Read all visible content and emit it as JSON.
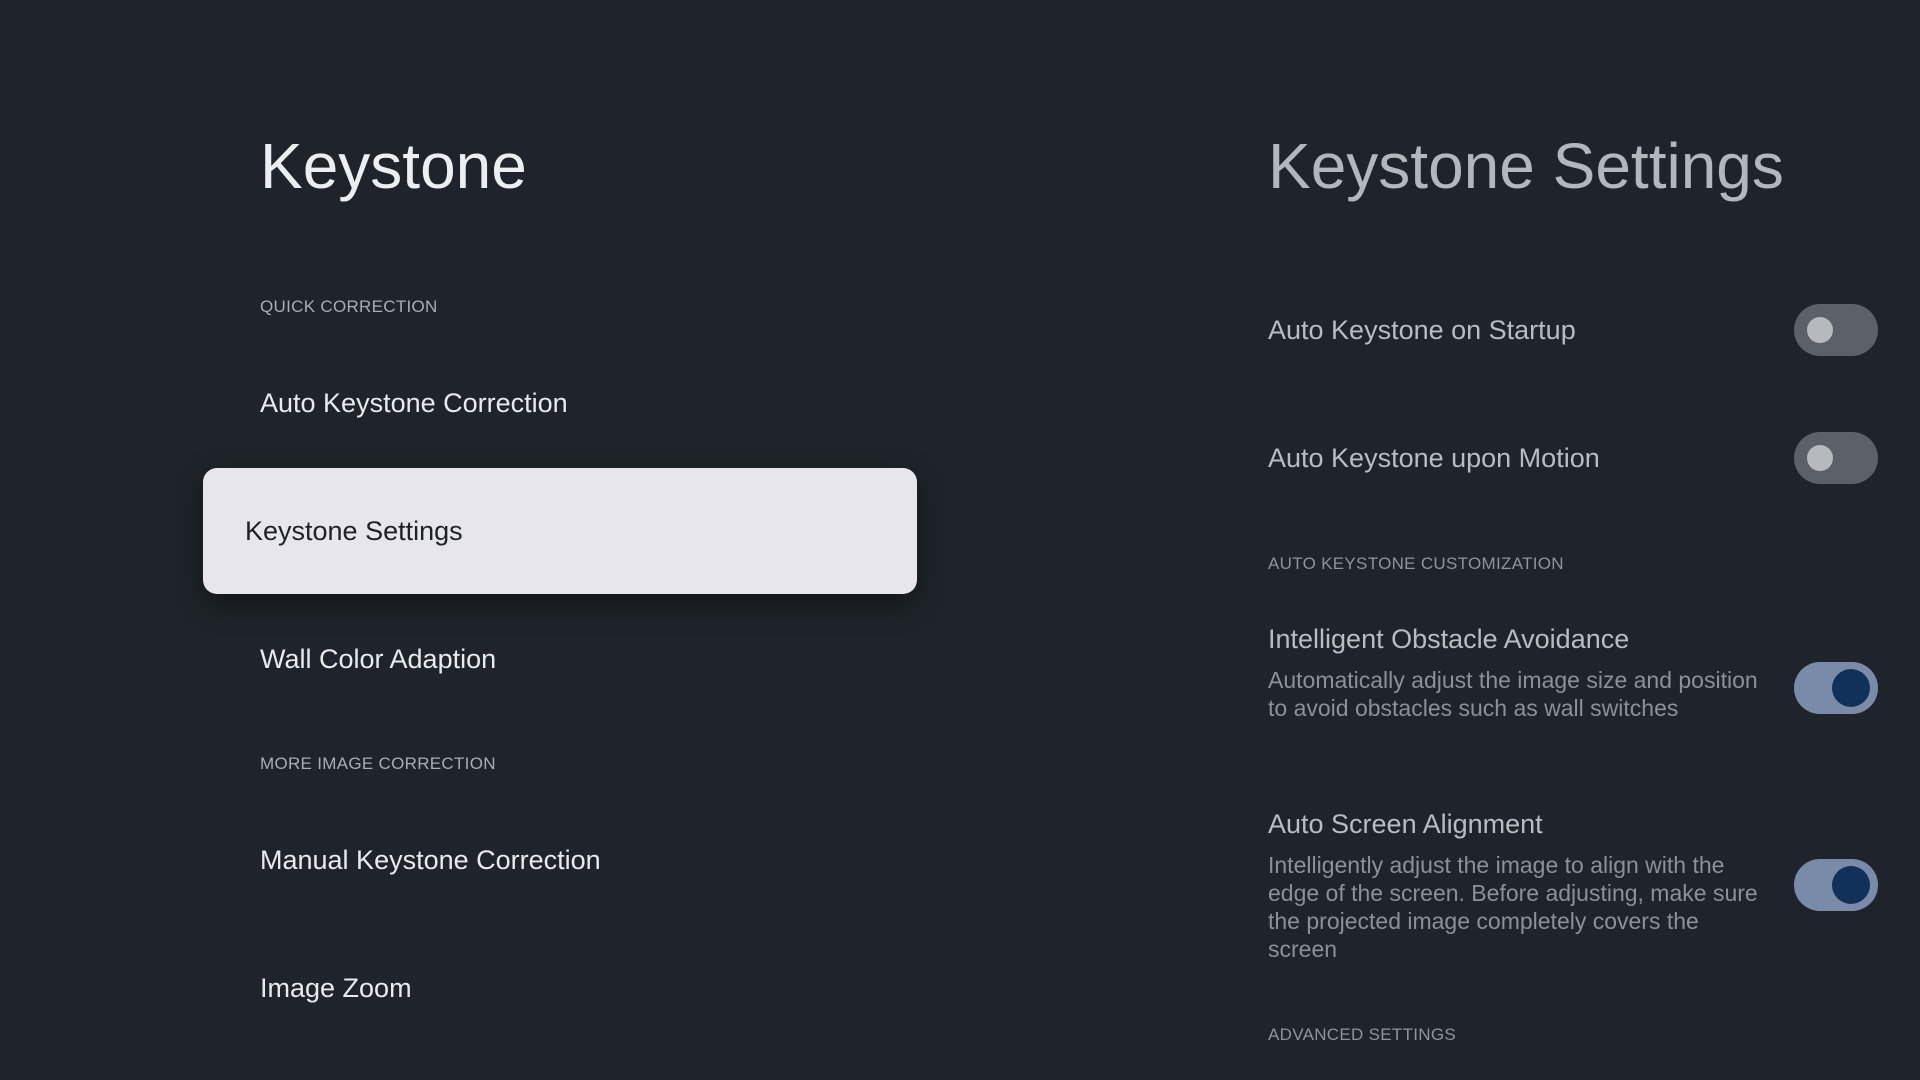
{
  "left": {
    "title": "Keystone",
    "sections": [
      {
        "header": "QUICK CORRECTION"
      },
      {
        "header": "MORE IMAGE CORRECTION"
      }
    ],
    "items": [
      {
        "label": "Auto Keystone Correction"
      },
      {
        "label": "Keystone Settings",
        "selected": true
      },
      {
        "label": "Wall Color Adaption"
      },
      {
        "label": "Manual Keystone Correction"
      },
      {
        "label": "Image Zoom"
      }
    ]
  },
  "right": {
    "title": "Keystone Settings",
    "settings": [
      {
        "title": "Auto Keystone on Startup",
        "toggle": "off"
      },
      {
        "title": "Auto Keystone upon Motion",
        "toggle": "off"
      },
      {
        "title": "Intelligent Obstacle Avoidance",
        "desc": "Automatically adjust the image size and position to avoid obstacles such as wall switches",
        "toggle": "on"
      },
      {
        "title": "Auto Screen Alignment",
        "desc": "Intelligently adjust the image to align with the edge of the screen. Before adjusting, make sure the projected image completely covers the screen",
        "toggle": "on"
      }
    ],
    "section_headers": {
      "customization": "AUTO KEYSTONE CUSTOMIZATION",
      "advanced": "ADVANCED SETTINGS"
    }
  },
  "colors": {
    "background": "#1f242c",
    "selected_bg": "#e6e6ec",
    "toggle_on_track": "#7a8aa9",
    "toggle_on_knob": "#12315a",
    "toggle_off_track": "#5c6068"
  }
}
